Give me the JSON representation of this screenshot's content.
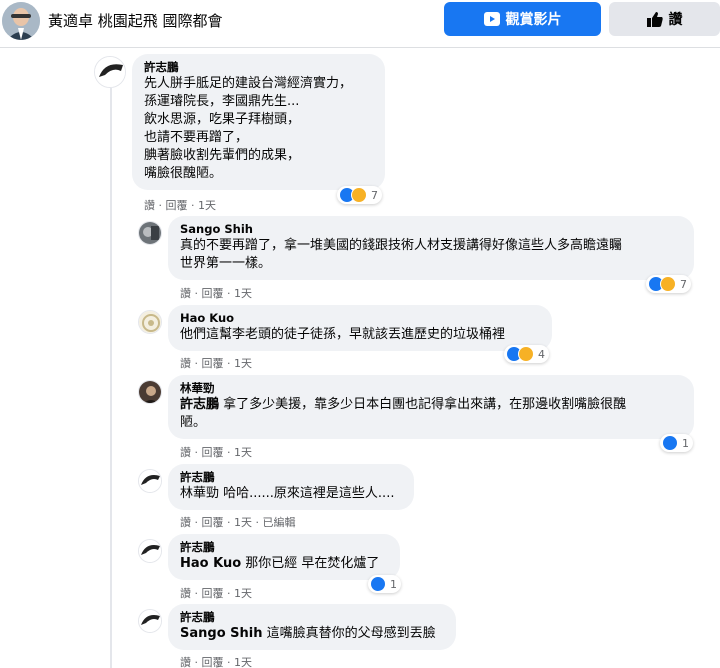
{
  "header": {
    "title": "黃適卓 桃園起飛 國際都會",
    "watch_label": "觀賞影片",
    "like_label": "讚"
  },
  "actions": {
    "like": "讚",
    "reply": "回覆",
    "sep": "·",
    "edited": "已編輯"
  },
  "comments": [
    {
      "author": "許志鵬",
      "text": "先人胼手胝足的建設台灣經濟實力，\n孫運璿院長，李國鼎先生...\n飲水思源，吃果子拜樹頭，\n也請不要再蹭了，\n腆著臉收割先輩們的成果，\n嘴臉很醜陋。",
      "time": "1天",
      "reactions": "7"
    },
    {
      "author": "Sango Shih",
      "text": "真的不要再蹭了，拿一堆美國的錢跟技術人材支援講得好像這些人多高瞻遠矚\n世界第一一樣。",
      "time": "1天",
      "reactions": "7"
    },
    {
      "author": "Hao Kuo",
      "text": "他們這幫李老頭的徒子徒孫，早就該丟進歷史的垃圾桶裡",
      "time": "1天",
      "reactions": "4"
    },
    {
      "author": "林華勁",
      "mention": "許志鵬",
      "text": " 拿了多少美援，靠多少日本白團也記得拿出來講，在那邊收割嘴臉很醜\n陋。",
      "time": "1天",
      "reactions": "1"
    },
    {
      "author": "許志鵬",
      "text": "林華勁 哈哈......原來這裡是這些人....",
      "time": "1天",
      "edited": true
    },
    {
      "author": "許志鵬",
      "mention": "Hao Kuo",
      "text": " 那你已經 早在焚化爐了",
      "time": "1天",
      "reactions": "1"
    },
    {
      "author": "許志鵬",
      "mention": "Sango Shih",
      "text": " 這嘴臉真替你的父母感到丟臉",
      "time": "1天"
    }
  ]
}
